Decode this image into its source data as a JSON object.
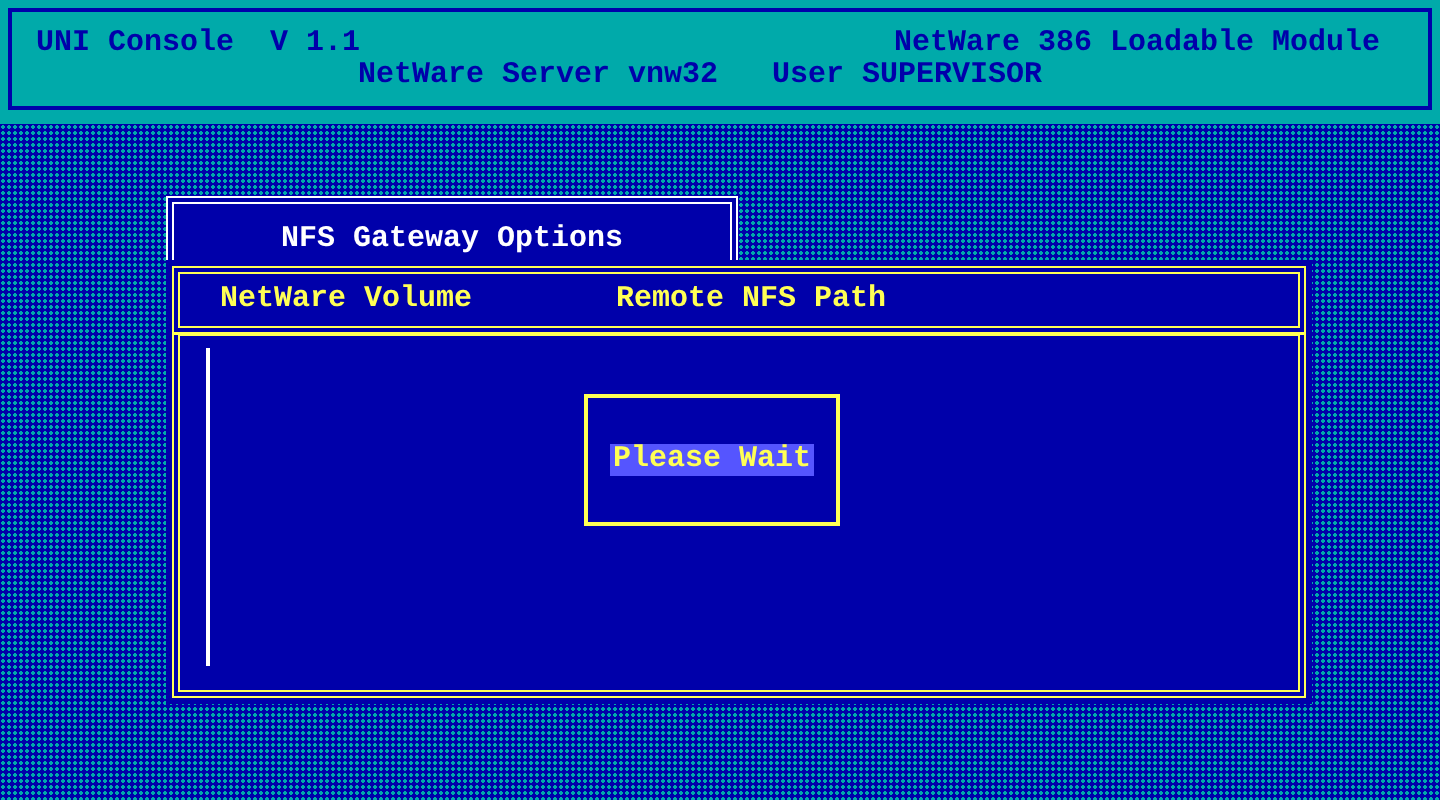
{
  "header": {
    "title": "UNI Console  V 1.1",
    "module": "NetWare 386 Loadable Module",
    "server": "NetWare Server vnw32",
    "user": "User SUPERVISOR"
  },
  "menu_window": {
    "title": "NFS Gateway Options"
  },
  "list_window": {
    "columns": [
      "NetWare Volume",
      "Remote NFS Path"
    ]
  },
  "dialog": {
    "message": "Please Wait"
  }
}
